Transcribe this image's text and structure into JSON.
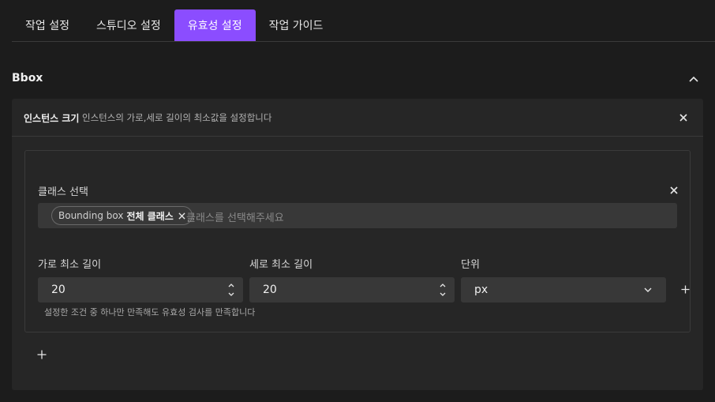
{
  "tabs": [
    {
      "label": "작업 설정",
      "active": false
    },
    {
      "label": "스튜디오 설정",
      "active": false
    },
    {
      "label": "유효성 설정",
      "active": true
    },
    {
      "label": "작업 가이드",
      "active": false
    }
  ],
  "section": {
    "title": "Bbox",
    "toggle_icon": "chevron-up-icon"
  },
  "rule": {
    "title": "인스턴스 크기",
    "description": "인스턴스의 가로,세로 길이의 최소값을 설정합니다"
  },
  "class_select": {
    "label": "클래스 선택",
    "tag_prefix": "Bounding box",
    "tag_bold": "전체 클래스",
    "placeholder": "클래스를 선택해주세요"
  },
  "fields": {
    "width_label": "가로 최소 길이",
    "width_value": "20",
    "height_label": "세로 최소 길이",
    "height_value": "20",
    "unit_label": "단위",
    "unit_value": "px"
  },
  "hint": "설정한 조건 중 하나만 만족해도 유효성 검사를 만족합니다",
  "colors": {
    "accent": "#8b4dff",
    "background": "#1c1c1c",
    "panel": "#262626",
    "input": "#383838"
  }
}
